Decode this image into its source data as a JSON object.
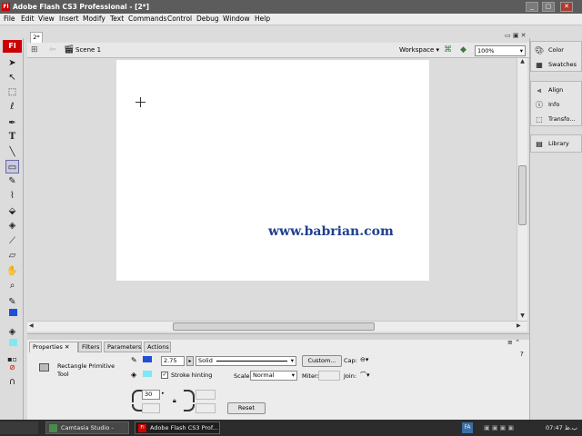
{
  "window": {
    "title": "Adobe Flash CS3 Professional - [2*]",
    "logo": "Fl",
    "controls": [
      "_",
      "▢",
      "✕"
    ]
  },
  "menu": [
    "File",
    "Edit",
    "View",
    "Insert",
    "Modify",
    "Text",
    "Commands",
    "Control",
    "Debug",
    "Window",
    "Help"
  ],
  "document": {
    "tab_label": "2*",
    "scene_label": "Scene 1",
    "workspace_label": "Workspace ▾",
    "zoom": "100%",
    "watermark": "www.babrian.com"
  },
  "toolbox": {
    "app_button": "Fl"
  },
  "panels": [
    {
      "label": "Color",
      "icon": "color-icon"
    },
    {
      "label": "Swatches",
      "icon": "swatches-icon"
    },
    {
      "label": "Align",
      "icon": "align-icon"
    },
    {
      "label": "Info",
      "icon": "info-icon"
    },
    {
      "label": "Transfo...",
      "icon": "transform-icon"
    },
    {
      "label": "Library",
      "icon": "library-icon"
    }
  ],
  "properties": {
    "tabs": [
      "Properties",
      "Filters",
      "Parameters",
      "Actions"
    ],
    "tool_name": "Rectangle Primitive Tool",
    "stroke_width": "2.75",
    "stroke_style": "Solid",
    "custom_button": "Custom...",
    "cap_label": "Cap:",
    "stroke_hinting_label": "Stroke hinting",
    "scale_label": "Scale:",
    "scale_value": "Normal",
    "miter_label": "Miter:",
    "join_label": "Join:",
    "corner_radius": "30",
    "reset_button": "Reset",
    "colors": {
      "stroke": "#1f4fd6",
      "fill": "#7fe8f5"
    }
  },
  "taskbar": {
    "items": [
      "Camtasia Studio - Unt...",
      "Adobe Flash CS3 Prof..."
    ],
    "clock": "07:47 ب.ظ"
  }
}
